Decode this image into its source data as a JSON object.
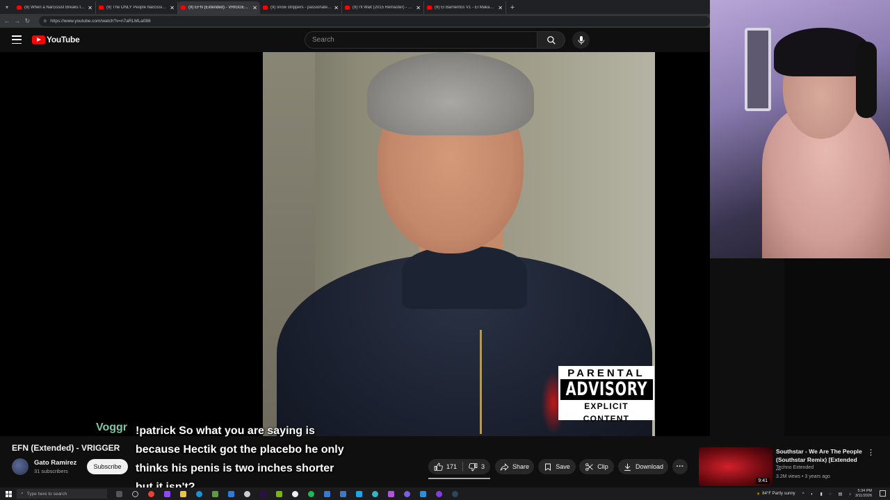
{
  "browser": {
    "tabs": [
      {
        "title": "(8) When a Narcissist Breaks the ...",
        "active": false
      },
      {
        "title": "(9) The ONLY People Narcissists St...",
        "active": false
      },
      {
        "title": "(9) EFN (Extended) - VRIGGER - Yo...",
        "active": true
      },
      {
        "title": "(9) snow strippers - passionate hi...",
        "active": false
      },
      {
        "title": "(9) I'll Wait (2015 Remaster) - YouT...",
        "active": false
      },
      {
        "title": "(9) El Barrientos V1 - El Makabelic...",
        "active": false
      }
    ],
    "url": "https://www.youtube.com/watch?v=n7aRLMLa088"
  },
  "youtube": {
    "logo_text": "YouTube",
    "search_placeholder": "Search"
  },
  "video": {
    "title": "EFN (Extended) - VRIGGER",
    "advisory": {
      "top": "PARENTAL",
      "middle": "ADVISORY",
      "bottom": "EXPLICIT CONTENT"
    },
    "channel": {
      "name": "Gato Ramirez",
      "subscribers": "31 subscribers"
    },
    "subscribe_label": "Subscribe",
    "likes": "171",
    "dislikes": "3",
    "share_label": "Share",
    "save_label": "Save",
    "clip_label": "Clip",
    "download_label": "Download"
  },
  "recommended": {
    "title": "Southstar - We Are The People (Southstar Remix) [Extended ...",
    "channel": "Techno Extended",
    "meta": "3.2M views • 3 years ago",
    "duration": "9:41"
  },
  "chat": {
    "user": "Voggr",
    "message": "!patrick So what you are saying is because Hectik got the placebo he only thinks his penis is two inches shorter but it isn't?"
  },
  "taskbar": {
    "search_placeholder": "Type here to search",
    "weather": "84°F Partly sunny",
    "time": "5:34 PM",
    "date": "3/11/2026"
  },
  "colors": {
    "youtube_red": "#ff0000",
    "chat_user": "#7fc6a6",
    "background": "#0f0f0f"
  }
}
